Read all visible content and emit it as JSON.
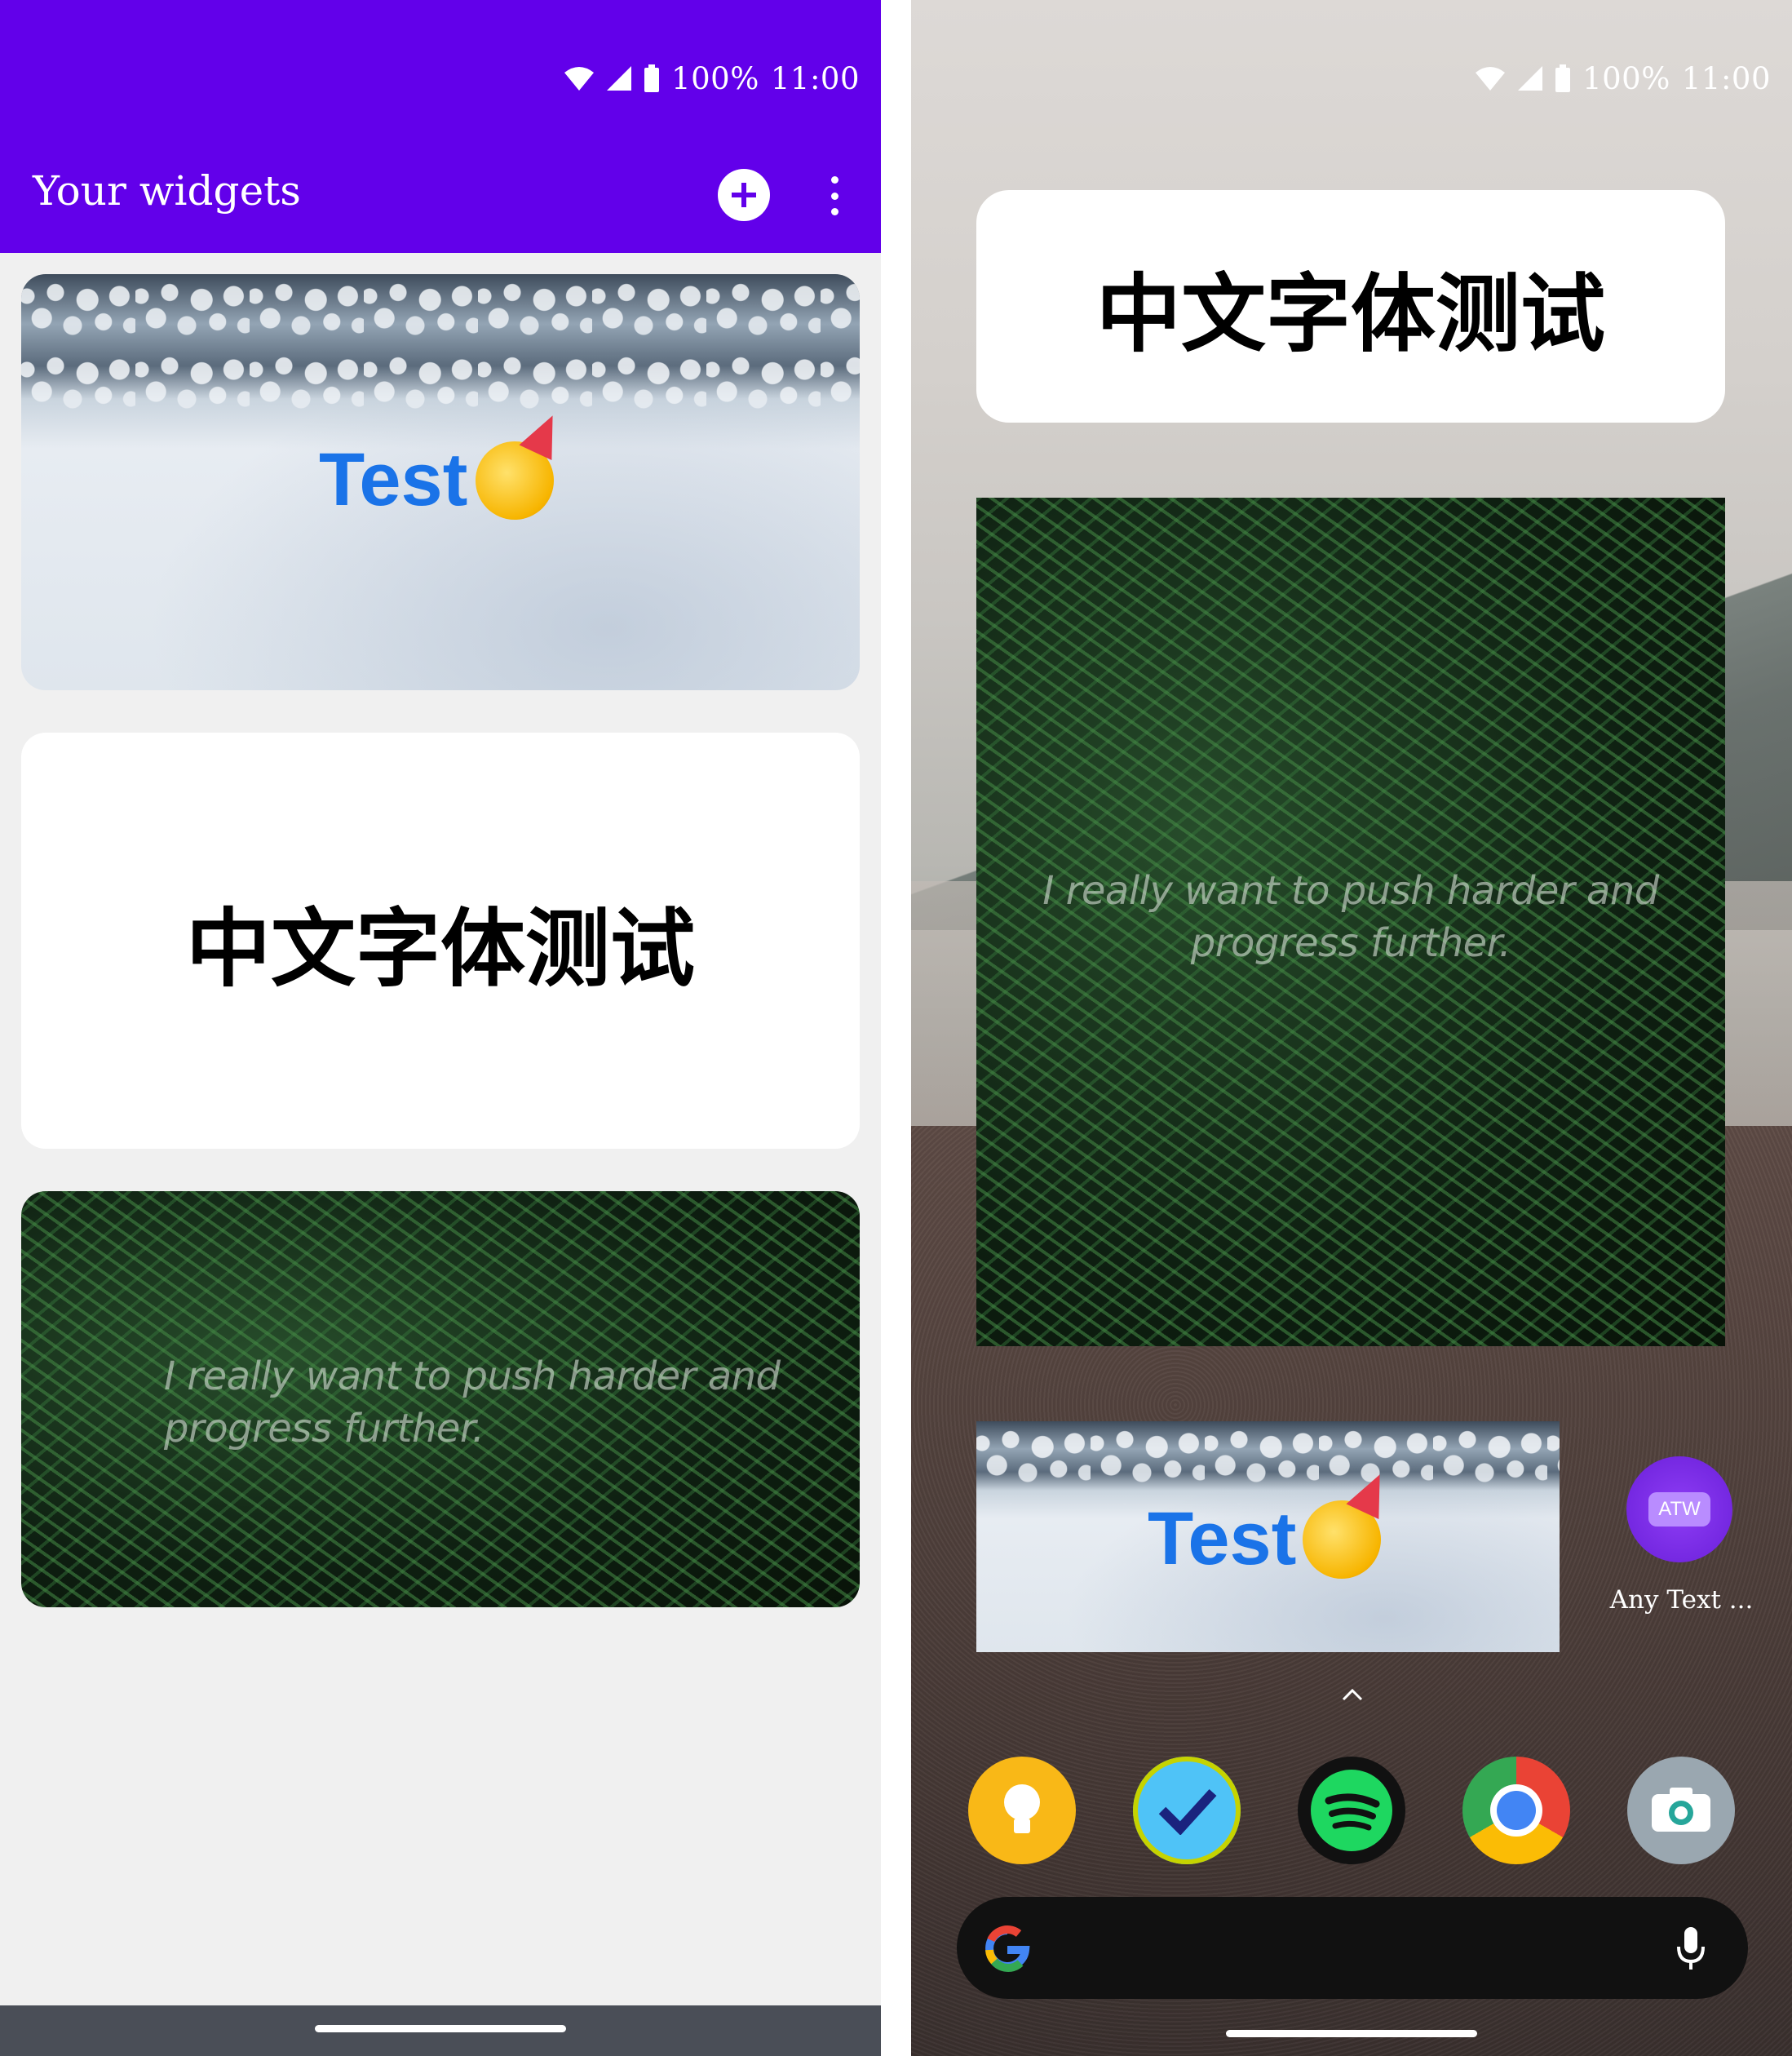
{
  "status_bar": {
    "battery": "100%",
    "time": "11:00"
  },
  "left": {
    "app_title": "Your widgets",
    "widgets": {
      "snow_widget_text": "Test",
      "chinese_widget_text": "中文字体测试",
      "fern_widget_quote_line1": "I really want to push harder and",
      "fern_widget_quote_line2": "progress further."
    },
    "icons": {
      "add": "plus-circle-icon",
      "menu": "more-vert-icon"
    },
    "colors": {
      "app_bar": "#6200ea",
      "background": "#f0f0f0",
      "test_text": "#1a73e8"
    }
  },
  "right": {
    "chinese_widget_text": "中文字体测试",
    "fern_widget_quote_line1": "I really want to push harder and",
    "fern_widget_quote_line2": "progress further.",
    "snow_widget_text": "Test",
    "app_shortcut": {
      "badge": "ATW",
      "label": "Any Text ..."
    },
    "dock": [
      "keep-notes-icon",
      "tasks-icon",
      "spotify-icon",
      "chrome-icon",
      "camera-icon"
    ],
    "search_bar_icons": [
      "google-logo-icon",
      "mic-icon"
    ]
  }
}
